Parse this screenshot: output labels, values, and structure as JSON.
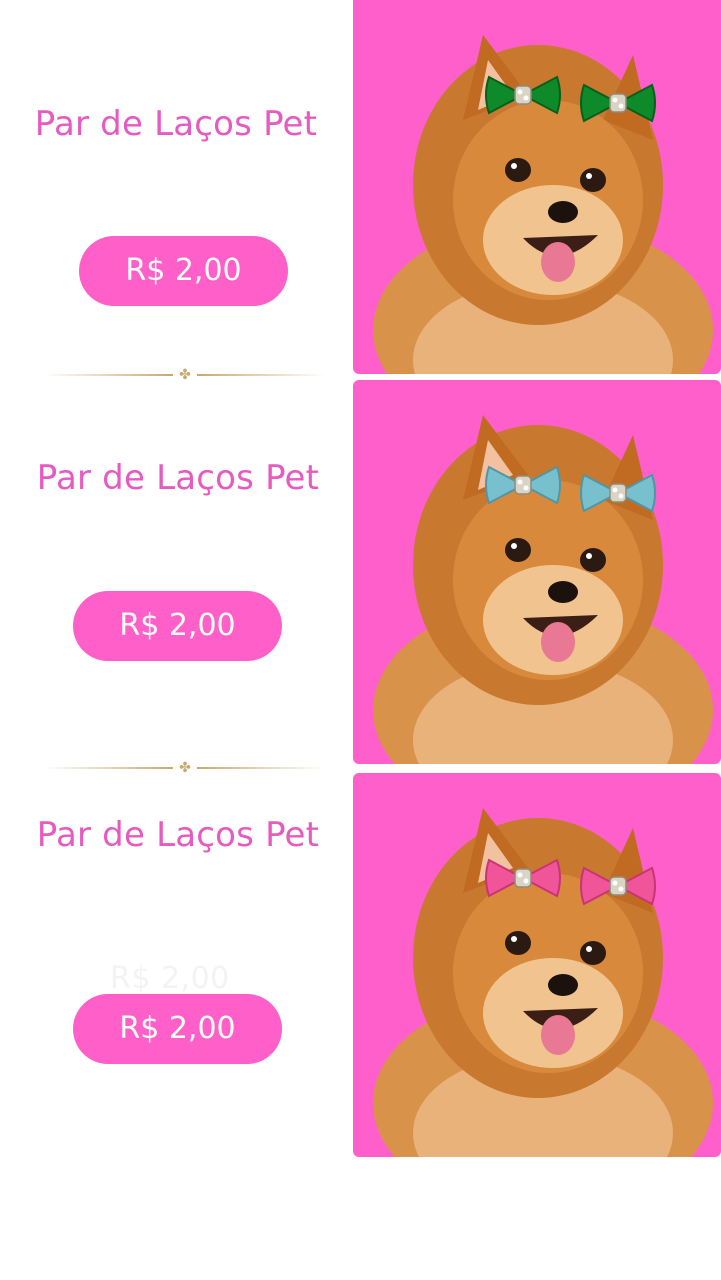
{
  "products": [
    {
      "title": "Par de Laços Pet",
      "price": "R$ 2,00",
      "bow_color": "#0f8a2a",
      "bow_color_dark": "#06601b"
    },
    {
      "title": "Par de Laços Pet",
      "price": "R$ 2,00",
      "bow_color": "#79c0cf",
      "bow_color_dark": "#4f97a8"
    },
    {
      "title": "Par de Laços Pet",
      "price": "R$ 2,00",
      "ghost_price": "R$ 2,00",
      "bow_color": "#f0559a",
      "bow_color_dark": "#c93474"
    }
  ],
  "divider_icon": "ornament-icon",
  "colors": {
    "accent_pink": "#ff5fc8",
    "title_pink": "#e65bbf",
    "photo_background": "#ff5fcb",
    "divider_gold": "#c9a86e"
  }
}
